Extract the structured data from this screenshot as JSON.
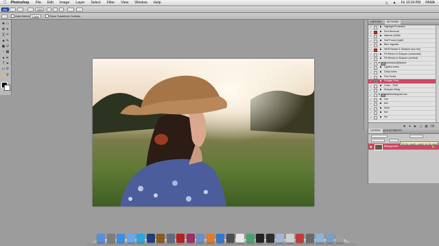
{
  "menubar": {
    "apple_icon": "apple-icon",
    "app_name": "Photoshop",
    "items": [
      "File",
      "Edit",
      "Image",
      "Layer",
      "Select",
      "Filter",
      "View",
      "Window",
      "Help"
    ],
    "clock": "Fri 10:24 PM",
    "user": "PAMA"
  },
  "appbar": {
    "logo": "Ps",
    "zoom": "33%"
  },
  "optionsbar": {
    "auto_select_label": "Auto-Select:",
    "auto_select_value": "Layer",
    "transform_label": "Show Transform Controls"
  },
  "actions_panel": {
    "tabs": [
      "HISTORY",
      "ACTIONS"
    ],
    "rows": [
      {
        "kind": "action",
        "label": "Highlight Protection",
        "modal": false
      },
      {
        "kind": "action",
        "label": "Red Removal",
        "modal": true
      },
      {
        "kind": "action",
        "label": "Warmer (Gold)",
        "modal": false
      },
      {
        "kind": "action",
        "label": "Soft Focus (Light)",
        "modal": false
      },
      {
        "kind": "action",
        "label": "Blue Vignette",
        "modal": false
      },
      {
        "kind": "action",
        "label": "WEB Resize & Sharpen (low res)",
        "modal": true
      },
      {
        "kind": "action",
        "label": "FB Resize & Sharpen (horizontal)",
        "modal": false
      },
      {
        "kind": "action",
        "label": "FB Resize & Sharpen (vertical)",
        "modal": false
      },
      {
        "kind": "set",
        "label": "JustJessicaMarcine",
        "modal": false
      },
      {
        "kind": "action",
        "label": "Lighten tones",
        "modal": false
      },
      {
        "kind": "action",
        "label": "Deep tones",
        "modal": false
      },
      {
        "kind": "action",
        "label": "Film Tones",
        "modal": false
      },
      {
        "kind": "action",
        "label": "Vintage Glow",
        "modal": false,
        "selected": true
      },
      {
        "kind": "action",
        "label": "Color... Stuff",
        "modal": false
      },
      {
        "kind": "action",
        "label": "Sharpen Efctg",
        "modal": false
      },
      {
        "kind": "set",
        "label": "claimfundingcall.one",
        "modal": false
      },
      {
        "kind": "action",
        "label": "one",
        "modal": false
      },
      {
        "kind": "action",
        "label": "two",
        "modal": false
      },
      {
        "kind": "action",
        "label": "three",
        "modal": false
      },
      {
        "kind": "action",
        "label": "five",
        "modal": false
      },
      {
        "kind": "action",
        "label": "the",
        "modal": false
      }
    ]
  },
  "layers_panel": {
    "tabs": [
      "LAYERS",
      "ADJUSTMENTS"
    ],
    "layer_name": "Background",
    "tooltip": "Set the master opacity for the layer"
  },
  "dock": {
    "icons": [
      "finder",
      "system-preferences",
      "safari",
      "itunes",
      "skype",
      "photoshop",
      "bridge",
      "camera-raw",
      "acrobat",
      "indesign",
      "mail",
      "firefox",
      "dropbox",
      "image-capture",
      "calendar",
      "maps",
      "chess",
      "terminal",
      "preview",
      "scripts",
      "photo-booth",
      "app",
      "stack",
      "stack",
      "trash"
    ]
  }
}
